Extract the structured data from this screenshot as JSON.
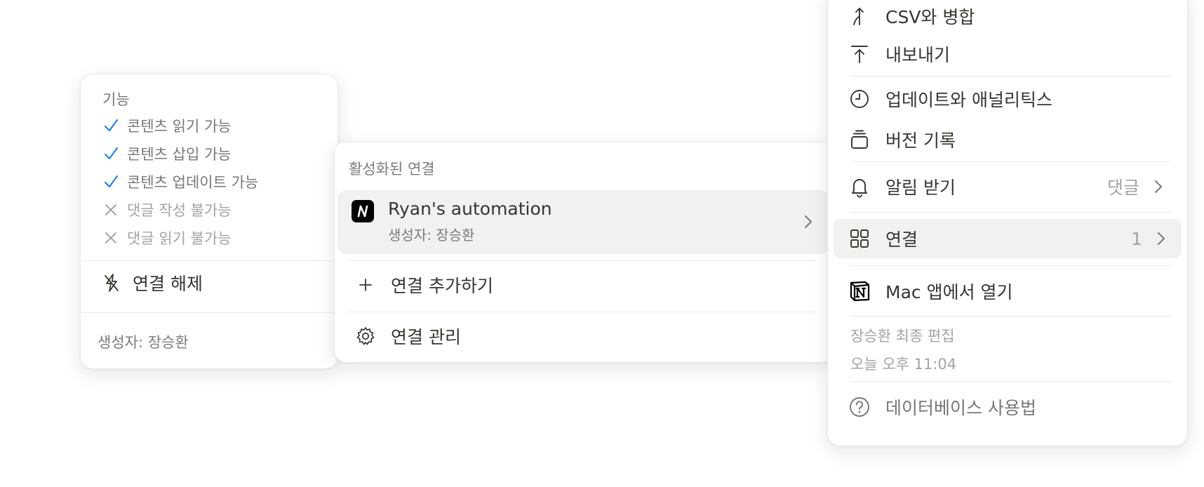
{
  "capabilities_panel": {
    "title": "기능",
    "items": [
      {
        "label": "콘텐츠 읽기 가능",
        "icon": "check-icon",
        "allowed": true
      },
      {
        "label": "콘텐츠 삽입 가능",
        "icon": "check-icon",
        "allowed": true
      },
      {
        "label": "콘텐츠 업데이트 가능",
        "icon": "check-icon",
        "allowed": true
      },
      {
        "label": "댓글 작성 불가능",
        "icon": "x-icon",
        "allowed": false
      },
      {
        "label": "댓글 읽기 불가능",
        "icon": "x-icon",
        "allowed": false
      }
    ],
    "disconnect_label": "연결 해제",
    "creator": "생성자: 장승환"
  },
  "connections_panel": {
    "section_title": "활성화된 연결",
    "active_connection": {
      "name": "Ryan's automation",
      "creator": "생성자: 장승환",
      "logo_glyph": "N"
    },
    "add_label": "연결 추가하기",
    "manage_label": "연결 관리"
  },
  "page_menu": {
    "merge_csv": "CSV와 병합",
    "export": "내보내기",
    "updates_analytics": "업데이트와 애널리틱스",
    "version_history": "버전 기록",
    "notifications": {
      "label": "알림 받기",
      "value": "댓글"
    },
    "connections": {
      "label": "연결",
      "value": "1"
    },
    "open_in_mac": "Mac 앱에서 열기",
    "last_edited_by": "장승환 최종 편집",
    "last_edited_time": "오늘 오후 11:04",
    "help": "데이터베이스 사용법"
  },
  "colors": {
    "check": "#2383e2",
    "muted_text": "#787774",
    "disabled_text": "#a5a39f",
    "hover_bg": "#f1f1ef"
  }
}
